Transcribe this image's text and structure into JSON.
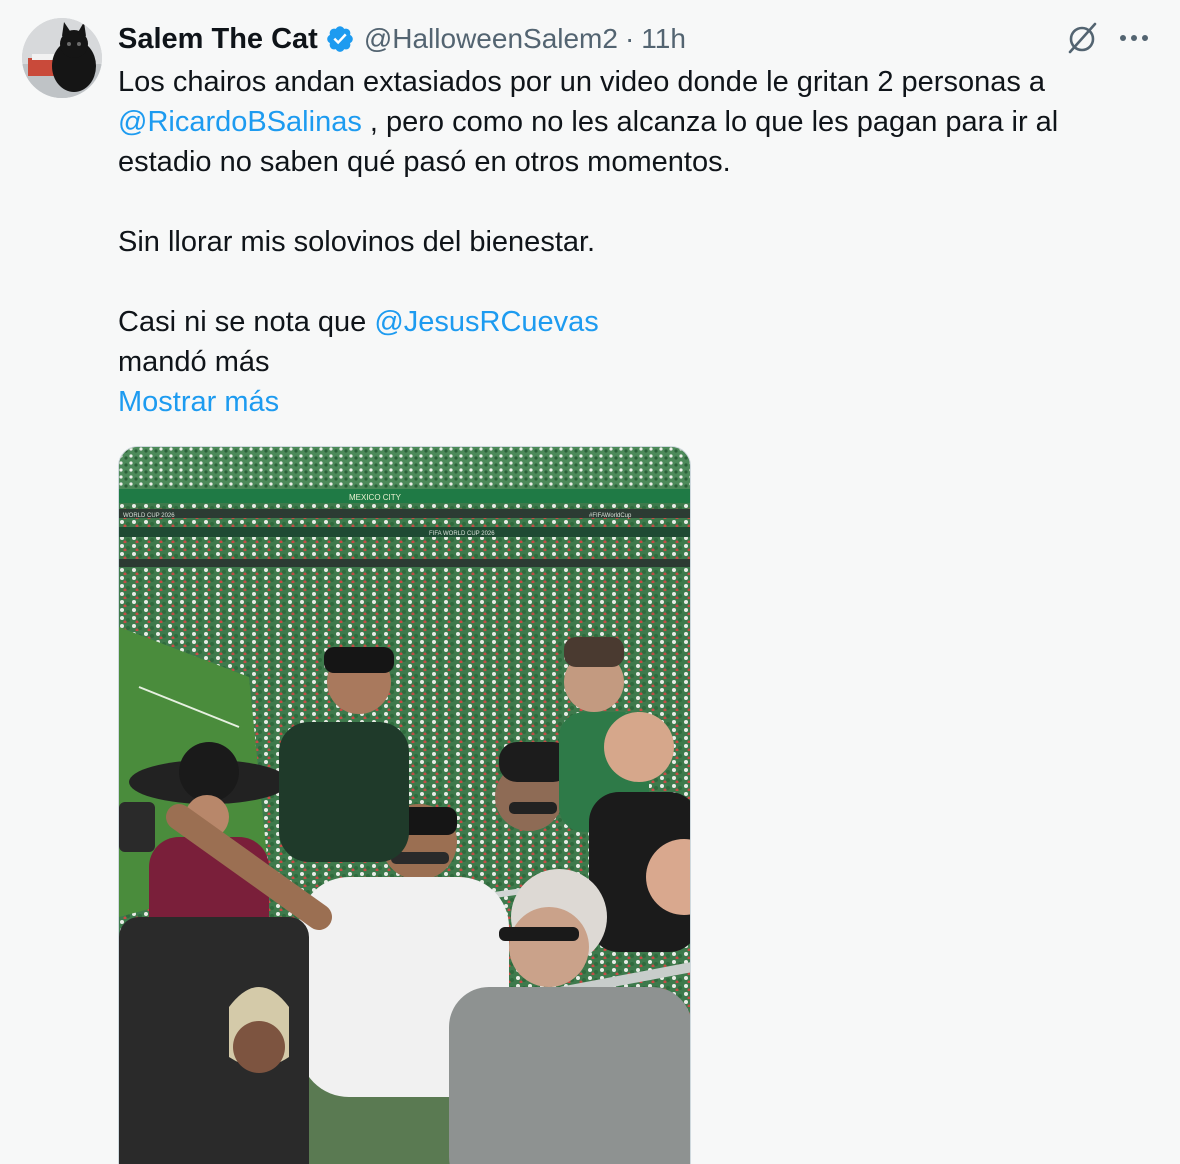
{
  "author": {
    "display_name": "Salem The Cat",
    "handle": "@HalloweenSalem2",
    "separator": "·",
    "timestamp": "11h",
    "verified": true
  },
  "tweet": {
    "line1": "Los chairos andan extasiados por un video donde le gritan 2 personas a",
    "mention1": "@RicardoBSalinas",
    "line2_rest": " , pero como no les alcanza lo que les pagan para ir al",
    "line3": "estadio no saben qué pasó en otros momentos.",
    "para2": "Sin llorar mis solovinos del bienestar.",
    "para3_start": "Casi ni se nota que ",
    "mention2": "@JesusRCuevas",
    "para3_end": "mandó más",
    "show_more": "Mostrar más"
  },
  "media": {
    "stadium_signs": [
      "MEXICO CITY",
      "FIFA WORLD CUP 2026",
      "WORLD CUP 2026",
      "#FIFAWorldCup"
    ]
  },
  "colors": {
    "background": "#f7f8f8",
    "text": "#0f1419",
    "muted": "#536471",
    "link": "#1d9bf0"
  },
  "icons": {
    "verified": "verified-badge-icon",
    "grok": "grok-icon",
    "more": "more-dots-icon"
  }
}
